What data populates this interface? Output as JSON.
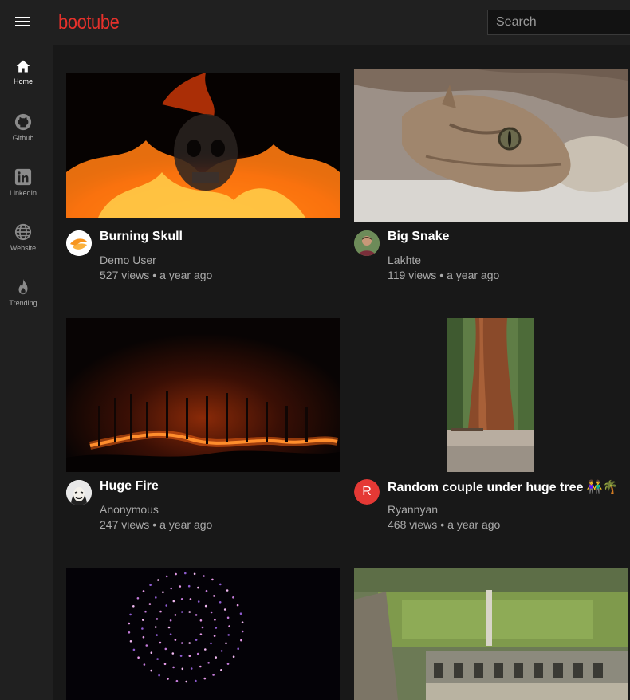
{
  "app": {
    "logo": "bootube"
  },
  "search": {
    "placeholder": "Search"
  },
  "sidebar": {
    "items": [
      {
        "label": "Home",
        "icon": "home-icon",
        "active": true
      },
      {
        "label": "Github",
        "icon": "github-icon"
      },
      {
        "label": "LinkedIn",
        "icon": "linkedin-icon"
      },
      {
        "label": "Website",
        "icon": "globe-icon"
      },
      {
        "label": "Trending",
        "icon": "fire-icon"
      }
    ]
  },
  "videos": [
    {
      "title": "Burning Skull",
      "channel": "Demo User",
      "views": "527 views",
      "age": "a year ago",
      "avatar": "orange-logo-avatar"
    },
    {
      "title": "Big Snake",
      "channel": "Lakhte",
      "views": "119 views",
      "age": "a year ago",
      "avatar": "photo-avatar"
    },
    {
      "title": "Huge Fire",
      "channel": "Anonymous",
      "views": "247 views",
      "age": "a year ago",
      "avatar": "mask-avatar"
    },
    {
      "title": "Random couple under huge tree 👫🌴",
      "channel": "Ryannyan",
      "views": "468 views",
      "age": "a year ago",
      "avatar": "letter-avatar",
      "avatar_letter": "R",
      "avatar_color": "#e53935"
    },
    {
      "title": "",
      "channel": "",
      "views": "",
      "age": ""
    },
    {
      "title": "",
      "channel": "",
      "views": "",
      "age": ""
    }
  ],
  "separator": "•",
  "colors": {
    "brand": "#e5312b",
    "background": "#181818",
    "panel": "#202020",
    "muted": "#aaaaaa"
  }
}
